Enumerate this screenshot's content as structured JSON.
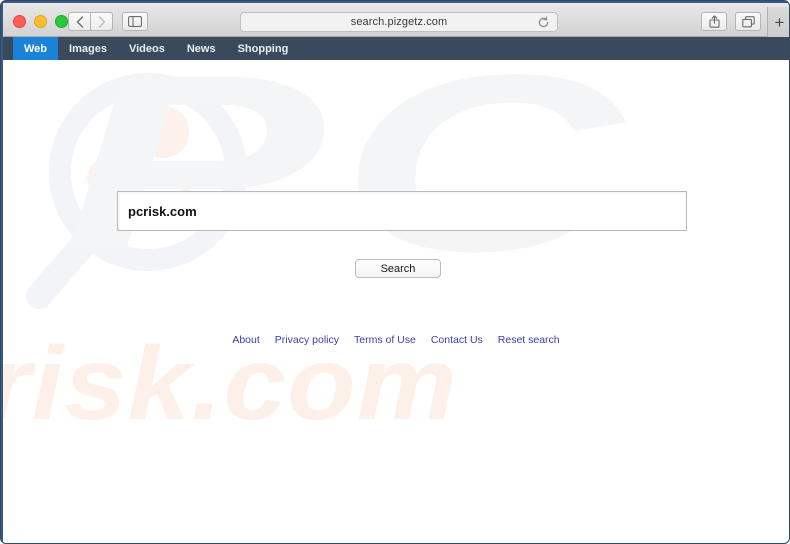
{
  "window": {
    "traffic_lights": [
      "close",
      "minimize",
      "zoom"
    ],
    "toolbar": {
      "back_icon": "chevron-left-icon",
      "forward_icon": "chevron-right-icon",
      "sidebar_icon": "sidebar-toggle-icon",
      "share_icon": "share-icon",
      "tabs_icon": "show-tabs-icon",
      "new_tab_label": "+"
    },
    "address_bar": {
      "url": "search.pizgetz.com",
      "reload_icon": "reload-icon"
    }
  },
  "site_nav": {
    "tabs": [
      {
        "label": "Web",
        "active": true
      },
      {
        "label": "Images",
        "active": false
      },
      {
        "label": "Videos",
        "active": false
      },
      {
        "label": "News",
        "active": false
      },
      {
        "label": "Shopping",
        "active": false
      }
    ]
  },
  "page": {
    "watermarks": {
      "magnifier_icon": "magnifying-glass-watermark",
      "pc_text": "PC",
      "risk_text": "risk.com"
    },
    "search": {
      "query": "pcrisk.com",
      "placeholder": "",
      "button_label": "Search"
    },
    "footer": {
      "links": [
        "About",
        "Privacy policy",
        "Terms of Use",
        "Contact Us",
        "Reset search"
      ]
    }
  },
  "colors": {
    "window_border": "#3c5880",
    "nav_bar": "#3a4a5c",
    "active_tab": "#1a82d8",
    "link": "#3b3fa8",
    "watermark_gray": "#f4f5f6",
    "watermark_peach": "#fdf0e8"
  }
}
